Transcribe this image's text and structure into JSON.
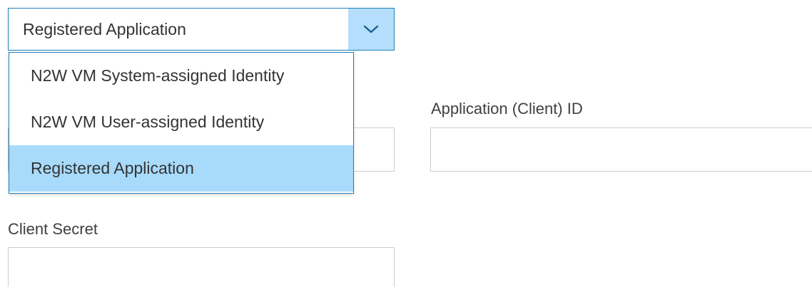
{
  "credential_type_select": {
    "value": "Registered Application",
    "toggle_icon": "chevron-down-icon",
    "options": [
      {
        "label": "N2W VM System-assigned Identity",
        "selected": false
      },
      {
        "label": "N2W VM User-assigned Identity",
        "selected": false
      },
      {
        "label": "Registered Application",
        "selected": true
      }
    ]
  },
  "fields": {
    "client_id": {
      "label": "Application (Client) ID",
      "value": ""
    },
    "client_secret": {
      "label": "Client Secret",
      "value": ""
    }
  },
  "colors": {
    "accent_border": "#1b80b7",
    "toggle_bg": "#b5defc",
    "selected_option_bg": "#a8dbfb"
  }
}
